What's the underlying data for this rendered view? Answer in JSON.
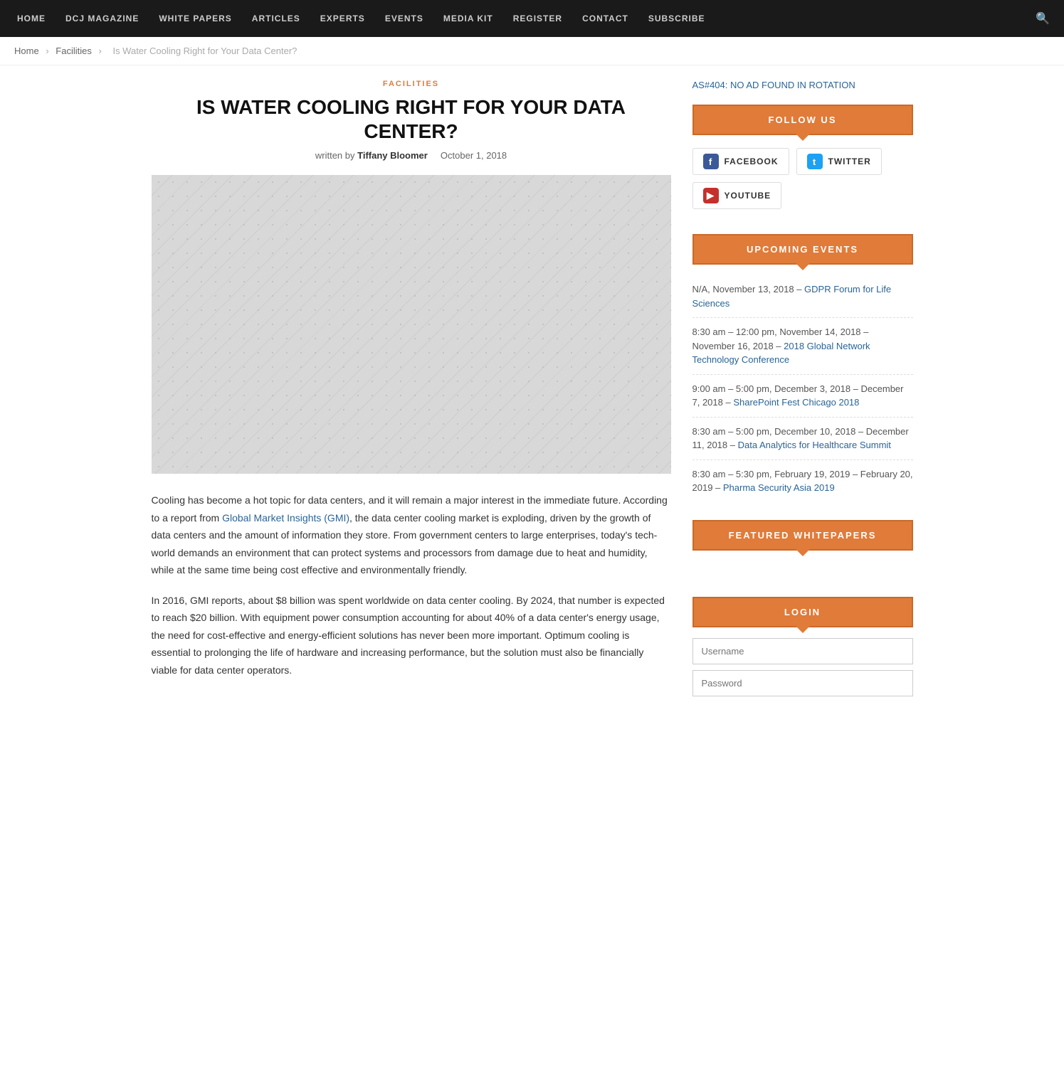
{
  "nav": {
    "items": [
      {
        "label": "HOME",
        "href": "#"
      },
      {
        "label": "DCJ MAGAZINE",
        "href": "#"
      },
      {
        "label": "WHITE PAPERS",
        "href": "#"
      },
      {
        "label": "ARTICLES",
        "href": "#"
      },
      {
        "label": "EXPERTS",
        "href": "#"
      },
      {
        "label": "EVENTS",
        "href": "#"
      },
      {
        "label": "MEDIA KIT",
        "href": "#"
      },
      {
        "label": "REGISTER",
        "href": "#"
      },
      {
        "label": "CONTACT",
        "href": "#"
      },
      {
        "label": "SUBSCRIBE",
        "href": "#"
      }
    ]
  },
  "breadcrumb": {
    "home": "Home",
    "facilities": "Facilities",
    "current": "Is Water Cooling Right for Your Data Center?"
  },
  "article": {
    "category": "FACILITIES",
    "title": "IS WATER COOLING RIGHT FOR YOUR DATA CENTER?",
    "written_by_label": "written by",
    "author": "Tiffany Bloomer",
    "date": "October 1, 2018",
    "body_p1": "Cooling has become a hot topic for data centers, and it will remain a major interest in the immediate future. According to a report from Global Market Insights (GMI), the data center cooling market is exploding, driven by the growth of data centers and the amount of information they store. From government centers to large enterprises, today's tech-world demands an environment that can protect systems and processors from damage due to heat and humidity, while at the same time being cost effective and environmentally friendly.",
    "gmi_link_text": "Global Market Insights (GMI)",
    "body_p2": "In 2016, GMI reports, about $8 billion was spent worldwide on data center cooling. By 2024, that number is expected to reach $20 billion. With equipment power consumption accounting for about 40% of a data center's energy usage, the need for cost-effective and energy-efficient solutions has never been more important. Optimum cooling is essential to prolonging the life of hardware and increasing performance, but the solution must also be financially viable for data center operators."
  },
  "sidebar": {
    "ad_note": "AS#404: NO AD FOUND IN ROTATION",
    "follow_us": {
      "header": "FOLLOW US",
      "facebook": "FACEBOOK",
      "twitter": "TWITTER",
      "youtube": "YOUTUBE"
    },
    "upcoming_events": {
      "header": "UPCOMING EVENTS",
      "events": [
        {
          "datetime": "N/A, November 13, 2018 –",
          "link_text": "GDPR Forum for Life Sciences",
          "href": "#"
        },
        {
          "datetime": "8:30 am – 12:00 pm, November 14, 2018 – November 16, 2018 –",
          "link_text": "2018 Global Network Technology Conference",
          "href": "#"
        },
        {
          "datetime": "9:00 am – 5:00 pm, December 3, 2018 – December 7, 2018 –",
          "link_text": "SharePoint Fest Chicago 2018",
          "href": "#"
        },
        {
          "datetime": "8:30 am – 5:00 pm, December 10, 2018 – December 11, 2018 –",
          "link_text": "Data Analytics for Healthcare Summit",
          "href": "#"
        },
        {
          "datetime": "8:30 am – 5:30 pm, February 19, 2019 – February 20, 2019 –",
          "link_text": "Pharma Security Asia 2019",
          "href": "#"
        }
      ]
    },
    "featured_whitepapers": {
      "header": "FEATURED WHITEPAPERS"
    },
    "login": {
      "header": "LOGIN",
      "username_placeholder": "Username",
      "password_placeholder": "Password"
    }
  }
}
